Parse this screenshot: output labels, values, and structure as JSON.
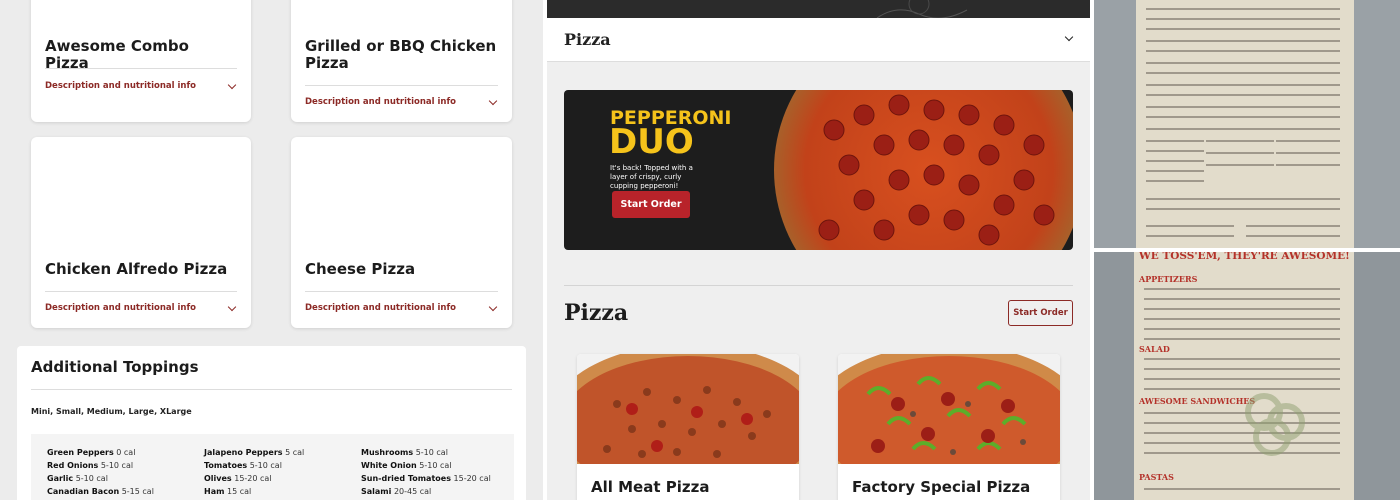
{
  "left_panel": {
    "cards": [
      {
        "title": "Awesome Combo Pizza",
        "desc": "Description and nutritional info"
      },
      {
        "title": "Grilled or BBQ Chicken Pizza",
        "desc": "Description and nutritional info"
      },
      {
        "title": "Chicken Alfredo Pizza",
        "desc": "Description and nutritional info"
      },
      {
        "title": "Cheese Pizza",
        "desc": "Description and nutritional info"
      }
    ],
    "toppings": {
      "title": "Additional Toppings",
      "sizes": "Mini, Small, Medium, Large, XLarge",
      "col1": [
        {
          "name": "Green Peppers",
          "cal": "0 cal"
        },
        {
          "name": "Red Onions",
          "cal": "5-10 cal"
        },
        {
          "name": "Garlic",
          "cal": "5-10 cal"
        },
        {
          "name": "Canadian Bacon",
          "cal": "5-15 cal"
        }
      ],
      "col2": [
        {
          "name": "Jalapeno Peppers",
          "cal": "5 cal"
        },
        {
          "name": "Tomatoes",
          "cal": "5-10 cal"
        },
        {
          "name": "Olives",
          "cal": "15-20 cal"
        },
        {
          "name": "Ham",
          "cal": "15 cal"
        }
      ],
      "col3": [
        {
          "name": "Mushrooms",
          "cal": "5-10 cal"
        },
        {
          "name": "White Onion",
          "cal": "5-10 cal"
        },
        {
          "name": "Sun-dried Tomatoes",
          "cal": "15-20 cal"
        },
        {
          "name": "Salami",
          "cal": "20-45 cal"
        }
      ]
    }
  },
  "middle_panel": {
    "dropdown_label": "Pizza",
    "promo": {
      "headline_1": "PEPPERONI",
      "headline_2": "DUO",
      "body": "It's back! Topped with a layer of crispy, curly cupping pepperoni!",
      "button": "Start Order"
    },
    "section_title": "Pizza",
    "section_button": "Start Order",
    "cards": [
      {
        "title": "All Meat Pizza"
      },
      {
        "title": "Factory Special Pizza"
      }
    ]
  },
  "right_panel": {
    "bottom_header": "WE TOSS'EM, THEY'RE AWESOME!",
    "sections": [
      "APPETIZERS",
      "SALAD",
      "AWESOME SANDWICHES",
      "PASTAS"
    ]
  },
  "colors": {
    "accent": "#8c2a26",
    "promo_yellow": "#f5c31b",
    "promo_button": "#b8232a"
  }
}
